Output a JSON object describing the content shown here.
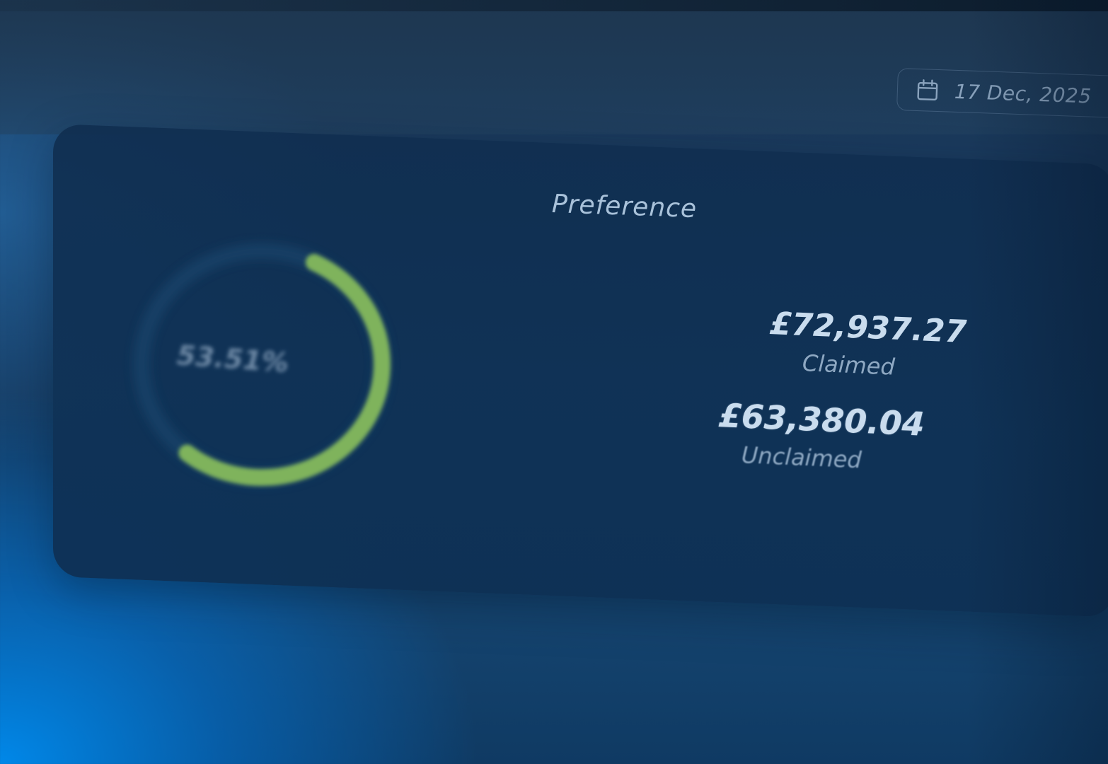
{
  "header": {
    "date": "17 Dec, 2025",
    "date_icon": "calendar-icon"
  },
  "card": {
    "title": "Preference",
    "ring": {
      "percent_label": "53.51%",
      "fraction": 0.5351,
      "track_color": "#1e4b73",
      "fill_color": "#7fb35c"
    },
    "stats": [
      {
        "amount": "£72,937.27",
        "label": "Claimed"
      },
      {
        "amount": "£63,380.04",
        "label": "Unclaimed"
      }
    ]
  },
  "colors": {
    "background_dark": "#15395e",
    "accent_blue": "#0a8be8",
    "text_light": "#c9dcee"
  }
}
